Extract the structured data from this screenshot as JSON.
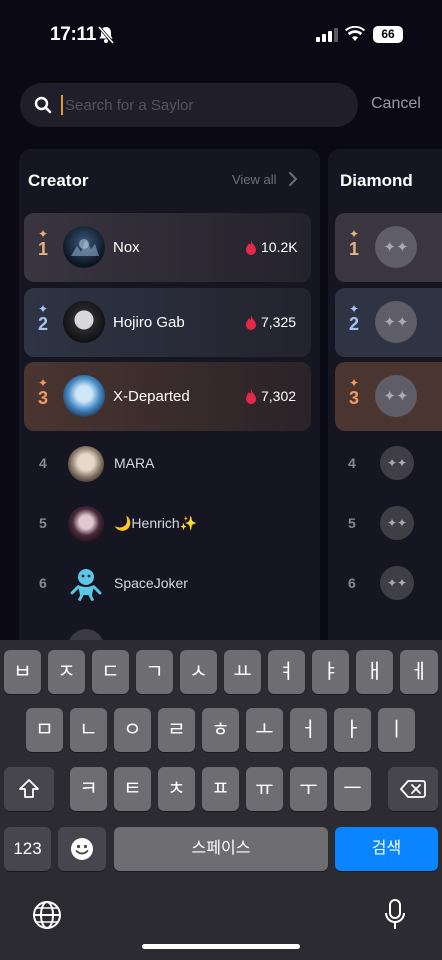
{
  "status": {
    "time": "17:11",
    "battery": "66"
  },
  "search": {
    "placeholder": "Search for a Saylor",
    "cancel": "Cancel"
  },
  "creator": {
    "title": "Creator",
    "view_all": "View all",
    "top": [
      {
        "rank": "1",
        "name": "Nox",
        "score": "10.2K",
        "color": "#e8b37a"
      },
      {
        "rank": "2",
        "name": "Hojiro Gab",
        "score": "7,325",
        "color": "#a9c3f2"
      },
      {
        "rank": "3",
        "name": "X-Departed",
        "score": "7,302",
        "color": "#f09a62"
      }
    ],
    "list": [
      {
        "rank": "4",
        "name": "MARA"
      },
      {
        "rank": "5",
        "name": "🌙Henrich✨"
      },
      {
        "rank": "6",
        "name": "SpaceJoker"
      }
    ]
  },
  "diamond": {
    "title": "Diamond",
    "ranks": [
      "1",
      "2",
      "3",
      "4",
      "5",
      "6"
    ]
  },
  "keyboard": {
    "row1": [
      "ㅂ",
      "ㅈ",
      "ㄷ",
      "ㄱ",
      "ㅅ",
      "ㅛ",
      "ㅕ",
      "ㅑ",
      "ㅐ",
      "ㅔ"
    ],
    "row2": [
      "ㅁ",
      "ㄴ",
      "ㅇ",
      "ㄹ",
      "ㅎ",
      "ㅗ",
      "ㅓ",
      "ㅏ",
      "ㅣ"
    ],
    "row3": [
      "ㅋ",
      "ㅌ",
      "ㅊ",
      "ㅍ",
      "ㅠ",
      "ㅜ",
      "ㅡ"
    ],
    "num": "123",
    "space": "스페이스",
    "search": "검색"
  },
  "colors": {
    "accent": "#0a84ff",
    "fire": "#e5284a"
  }
}
